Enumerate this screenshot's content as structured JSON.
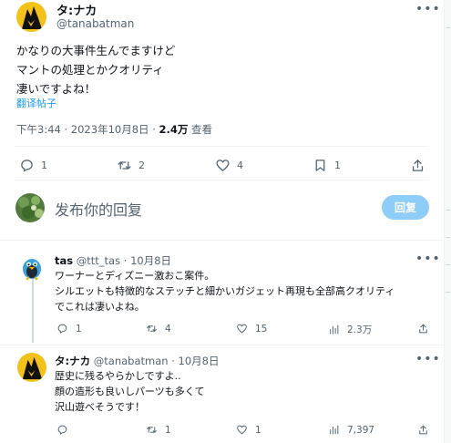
{
  "main_post": {
    "author_name": "タ:ナカ",
    "author_handle": "@tanabatman",
    "more_label": "•••",
    "text_lines": [
      "かなりの大事件生んでますけど",
      "マントの処理とかクオリティ",
      "凄いですよね！"
    ],
    "translate_label": "翻译帖子",
    "time": "下午3:44",
    "date": "2023年10月8日",
    "views_count": "2.4万",
    "views_label": "查看",
    "actions": {
      "replies": "1",
      "reposts": "2",
      "likes": "4",
      "bookmarks": "1"
    }
  },
  "composer": {
    "placeholder": "发布你的回复",
    "reply_button": "回复"
  },
  "replies": [
    {
      "author_name": "tas",
      "author_handle": "@ttt_tas",
      "date": "10月8日",
      "text_lines": [
        "ワーナーとディズニー激おこ案件。",
        "シルエットも特徴的なステッチと細かいガジェット再現も全部高クオリティ",
        "でこれは凄いよね。"
      ],
      "actions": {
        "replies": "1",
        "reposts": "4",
        "likes": "15",
        "views": "2.3万"
      }
    },
    {
      "author_name": "タ:ナカ",
      "author_handle": "@tanabatman",
      "date": "10月8日",
      "text_lines": [
        "歴史に残るやらかしですよ..",
        "顔の造形も良いしパーツも多くて",
        "沢山遊べそうです！"
      ],
      "actions": {
        "replies": "",
        "reposts": "1",
        "likes": "1",
        "views": "7,397"
      }
    }
  ],
  "colors": {
    "accent": "#1d9bf0",
    "reply_button_disabled": "#8ecdf8",
    "secondary_text": "#536471",
    "divider": "#eff3f4"
  },
  "icons": {
    "reply": "speech-bubble-icon",
    "repost": "repost-arrows-icon",
    "like": "heart-icon",
    "bookmark": "bookmark-icon",
    "share": "share-upload-icon",
    "views": "bar-chart-icon"
  }
}
